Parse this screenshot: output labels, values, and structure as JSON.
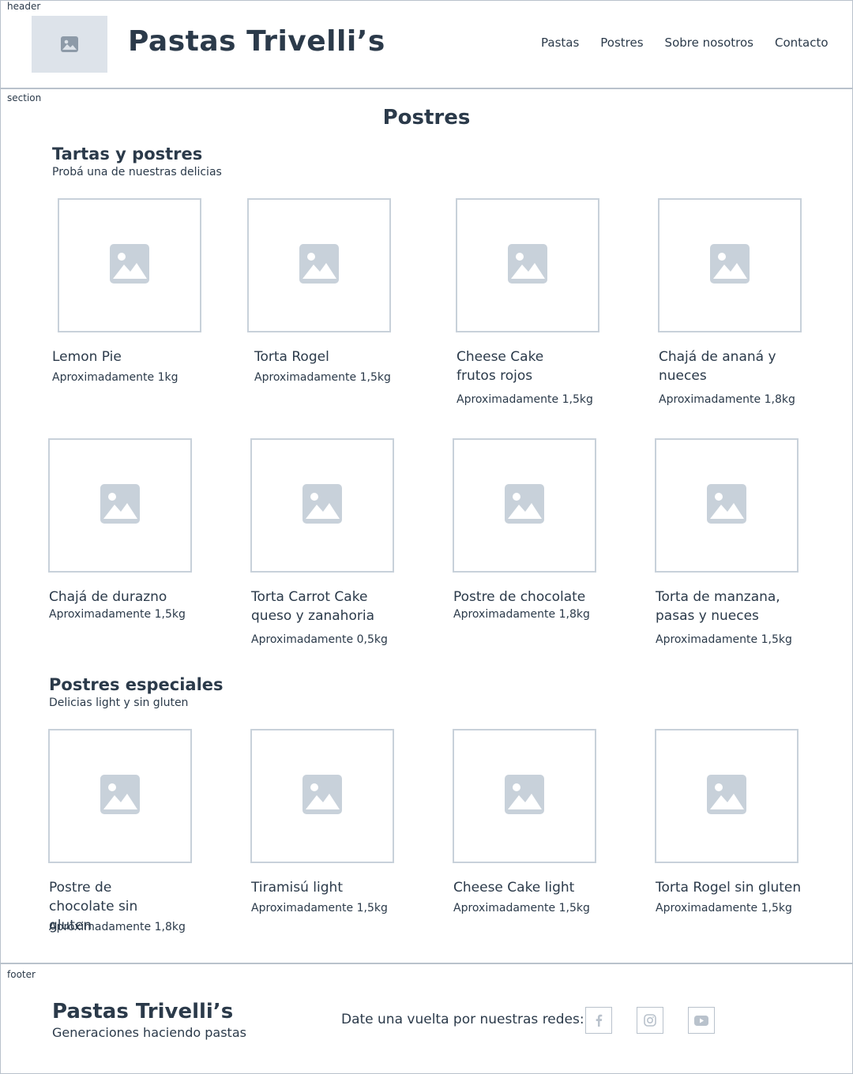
{
  "frames": {
    "header": "header",
    "section": "section",
    "footer": "footer"
  },
  "header": {
    "brand": "Pastas Trivelli’s",
    "nav": [
      "Pastas",
      "Postres",
      "Sobre nosotros",
      "Contacto"
    ]
  },
  "main": {
    "title": "Postres",
    "groups": [
      {
        "title": "Tartas y postres",
        "subtitle": "Probá una de nuestras delicias",
        "items": [
          {
            "name": "Lemon Pie",
            "meta": "Aproximadamente 1kg"
          },
          {
            "name": "Torta Rogel",
            "meta": "Aproximadamente 1,5kg"
          },
          {
            "name": "Cheese Cake frutos rojos",
            "meta": "Aproximadamente 1,5kg"
          },
          {
            "name": "Chajá de ananá y nueces",
            "meta": "Aproximadamente 1,8kg"
          },
          {
            "name": "Chajá de durazno",
            "meta": "Aproximadamente 1,5kg"
          },
          {
            "name": "Torta Carrot Cake queso y zanahoria",
            "meta": "Aproximadamente 0,5kg"
          },
          {
            "name": "Postre de chocolate",
            "meta": "Aproximadamente 1,8kg"
          },
          {
            "name": "Torta de manzana, pasas y nueces",
            "meta": "Aproximadamente 1,5kg"
          }
        ]
      },
      {
        "title": "Postres especiales",
        "subtitle": "Delicias light y sin gluten",
        "items": [
          {
            "name": "Postre de chocolate sin gluten",
            "meta": "Aproximadamente 1,8kg"
          },
          {
            "name": "Tiramisú light",
            "meta": "Aproximadamente 1,5kg"
          },
          {
            "name": "Cheese Cake light",
            "meta": "Aproximadamente 1,5kg"
          },
          {
            "name": "Torta Rogel sin gluten",
            "meta": "Aproximadamente 1,5kg"
          }
        ]
      }
    ]
  },
  "footer": {
    "brand": "Pastas Trivelli’s",
    "tagline": "Generaciones haciendo pastas",
    "social_text": "Date una vuelta por nuestras redes:",
    "social": [
      "facebook-icon",
      "instagram-icon",
      "youtube-icon"
    ]
  },
  "colors": {
    "text": "#2b3a4a",
    "placeholder": "#c8d1da",
    "border": "#b9c2cc"
  }
}
